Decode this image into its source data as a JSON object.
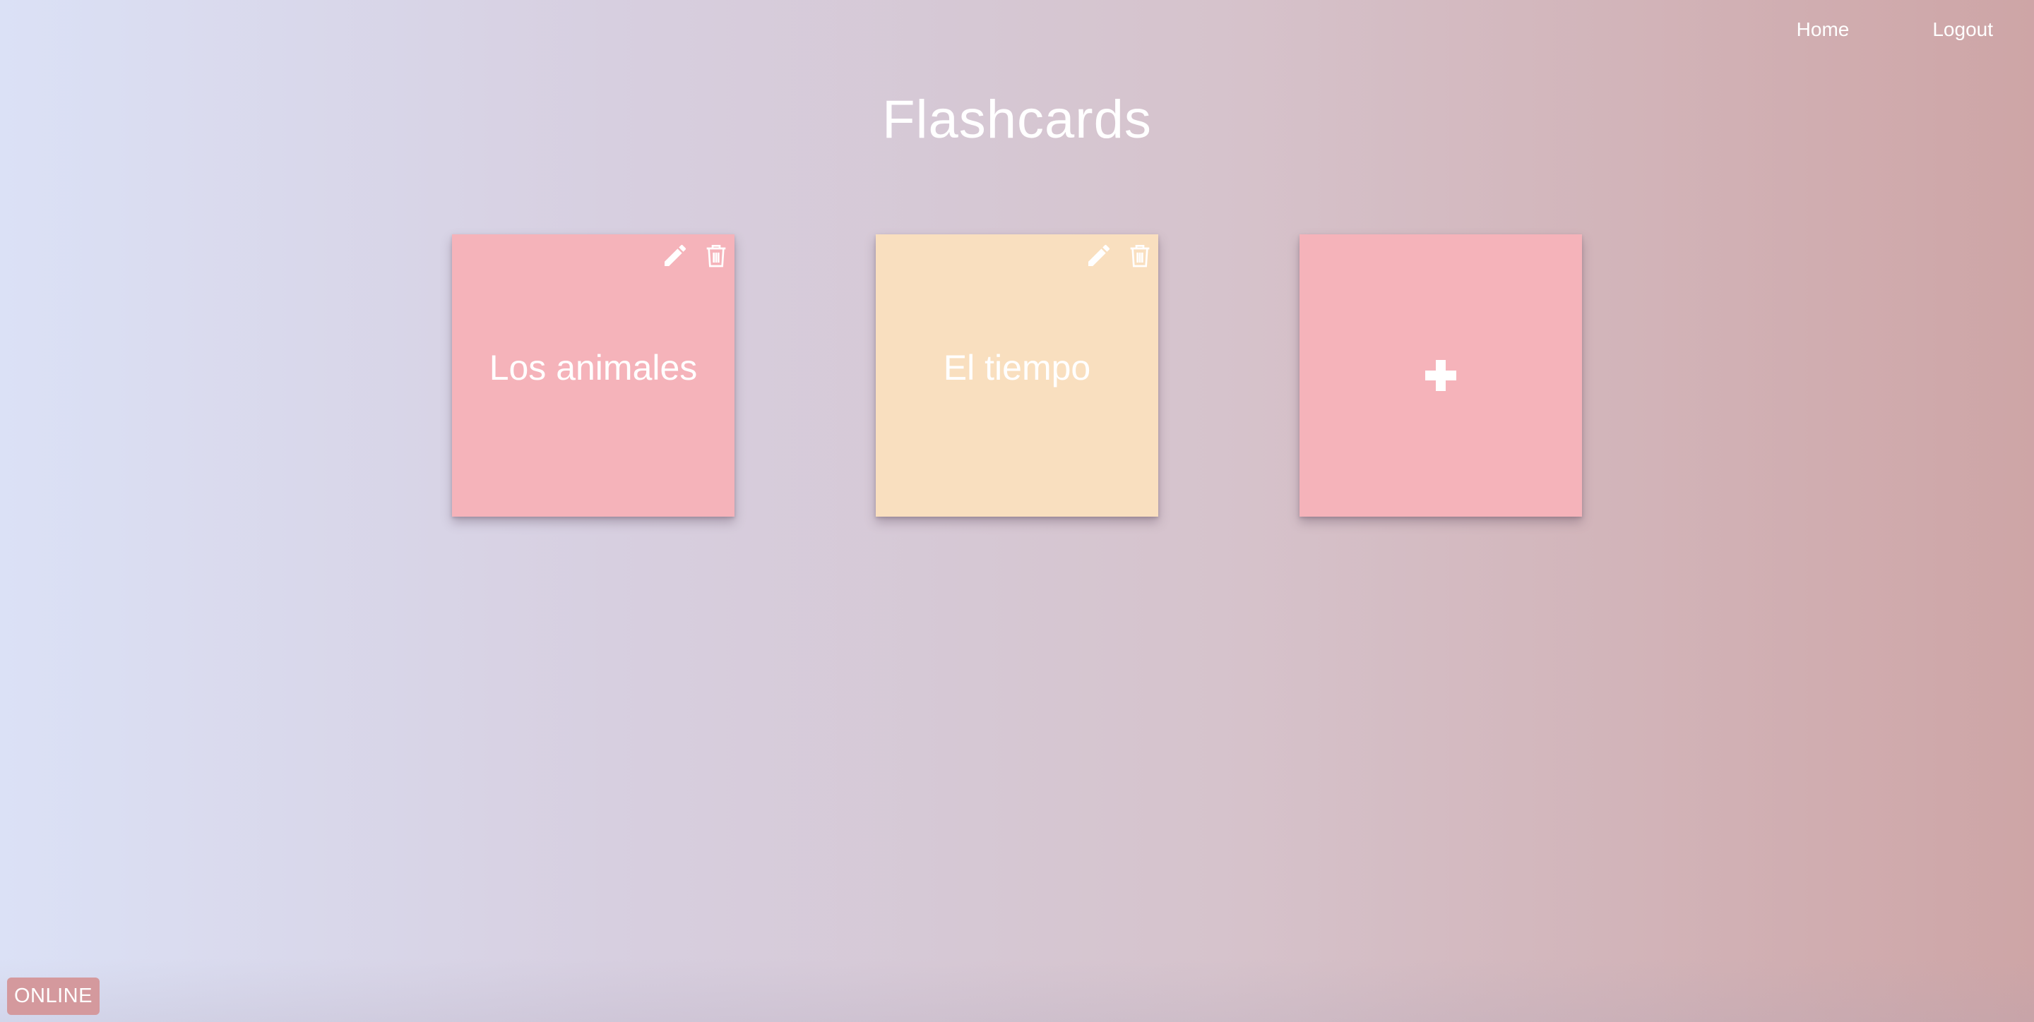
{
  "nav": {
    "home_label": "Home",
    "logout_label": "Logout"
  },
  "page": {
    "title": "Flashcards"
  },
  "decks": [
    {
      "name": "Los animales",
      "color": "#f5b3ba",
      "edit_icon": "pencil-icon",
      "delete_icon": "trash-icon"
    },
    {
      "name": "El tiempo",
      "color": "#f9dfbf",
      "edit_icon": "pencil-icon",
      "delete_icon": "trash-icon"
    }
  ],
  "add_deck": {
    "icon": "plus-icon",
    "color": "#f5b3ba"
  },
  "status": {
    "label": "ONLINE",
    "color": "#d4999d"
  },
  "theme": {
    "gradient_start": "#dbe1f6",
    "gradient_end": "#cea5a6"
  }
}
